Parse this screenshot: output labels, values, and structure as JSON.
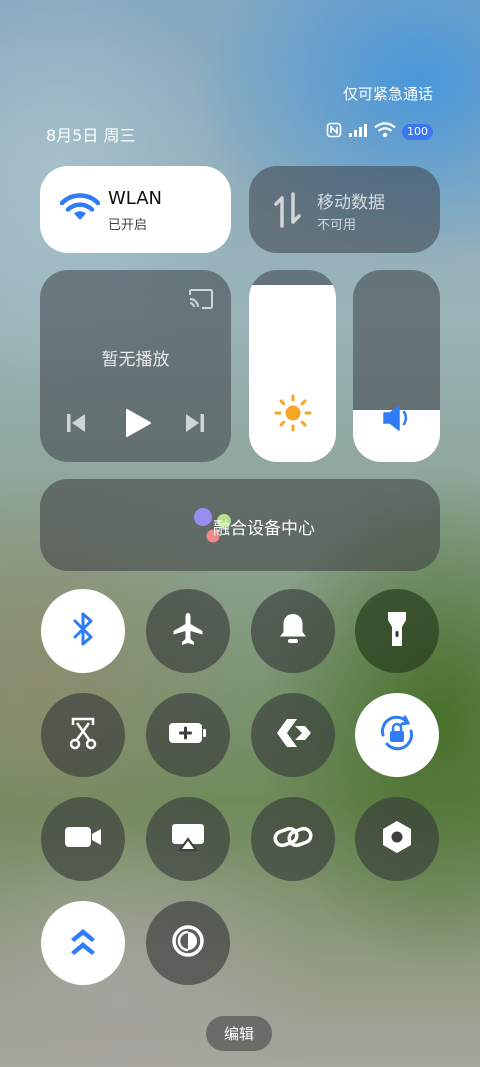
{
  "status": {
    "emergency_text": "仅可紧急通话",
    "date_text": "8月5日 周三",
    "battery_text": "100"
  },
  "tiles": {
    "wlan": {
      "title": "WLAN",
      "subtitle": "已开启"
    },
    "mobile_data": {
      "title": "移动数据",
      "subtitle": "不可用"
    }
  },
  "media": {
    "status_text": "暂无播放"
  },
  "sliders": {
    "brightness_level": 0.92,
    "volume_level": 0.27
  },
  "fusion_device_center": {
    "label": "融合设备中心"
  },
  "toggles": [
    {
      "icon": "bluetooth-icon",
      "active": true
    },
    {
      "icon": "airplane-icon",
      "active": false
    },
    {
      "icon": "bell-icon",
      "active": false
    },
    {
      "icon": "flashlight-icon",
      "active": false
    },
    {
      "icon": "screenshot-scissors-icon",
      "active": false
    },
    {
      "icon": "battery-saver-icon",
      "active": false
    },
    {
      "icon": "share-icon",
      "active": false
    },
    {
      "icon": "rotation-lock-icon",
      "active": true
    },
    {
      "icon": "video-camera-icon",
      "active": false
    },
    {
      "icon": "screen-cast-icon",
      "active": false
    },
    {
      "icon": "link-icon",
      "active": false
    },
    {
      "icon": "nfc-hexagon-icon",
      "active": false
    },
    {
      "icon": "performance-icon",
      "active": true
    },
    {
      "icon": "eye-comfort-icon",
      "active": false
    }
  ],
  "edit_button": {
    "label": "编辑"
  },
  "colors": {
    "accent": "#2f7cf6",
    "sun": "#f5a623"
  }
}
